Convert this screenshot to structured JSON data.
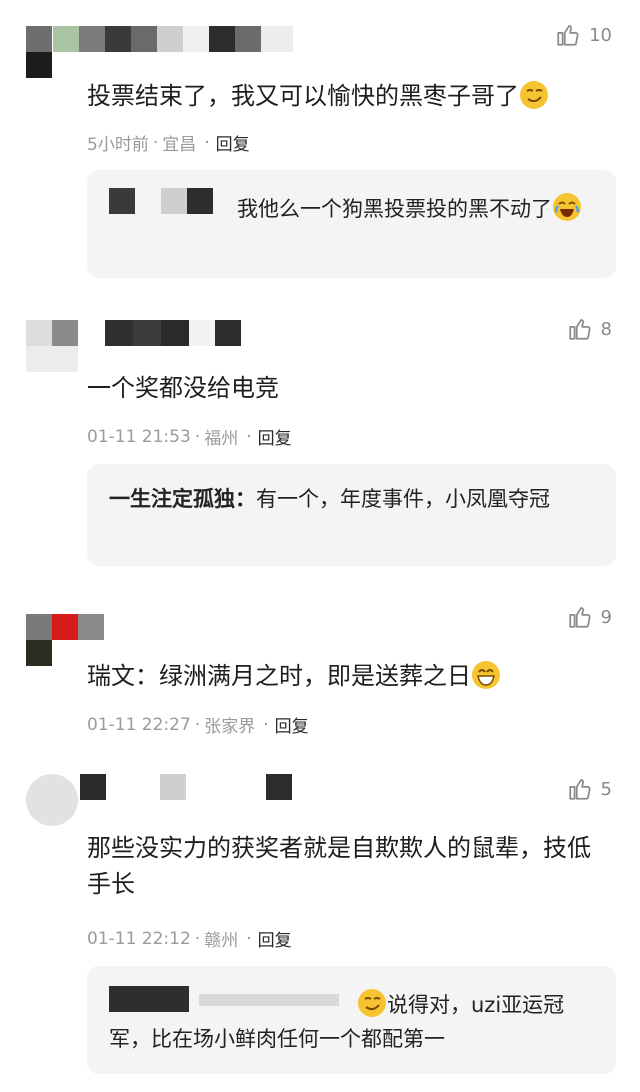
{
  "comments": [
    {
      "likes": "10",
      "text": "投票结束了，我又可以愉快的黑枣子哥了",
      "emoji": "smirk-emoji",
      "time": "5小时前",
      "location": "宜昌",
      "reply_label": "回复",
      "reply": {
        "author": "",
        "text": "我他么一个狗黑投票投的黑不动了",
        "emoji": "laugh-tears-emoji"
      }
    },
    {
      "likes": "8",
      "text": "一个奖都没给电竞",
      "time": "01-11 21:53",
      "location": "福州",
      "reply_label": "回复",
      "reply": {
        "author": "一生注定孤独：",
        "text": "有一个，年度事件，小凤凰夺冠"
      }
    },
    {
      "likes": "9",
      "text": "瑞文：绿洲满月之时，即是送葬之日",
      "emoji": "grin-emoji",
      "time": "01-11 22:27",
      "location": "张家界",
      "reply_label": "回复"
    },
    {
      "likes": "5",
      "text": "那些没实力的获奖者就是自欺欺人的鼠辈，技低手长",
      "time": "01-11 22:12",
      "location": "赣州",
      "reply_label": "回复",
      "reply": {
        "author": "",
        "text": "说得对，uzi亚运冠军，比在场小鲜肉任何一个都配第一",
        "emoji": "smirk-emoji"
      }
    }
  ],
  "colors": {
    "meta": "#9a9a9a",
    "reply_bg": "#f4f4f4",
    "emoji": "#f6c431"
  }
}
